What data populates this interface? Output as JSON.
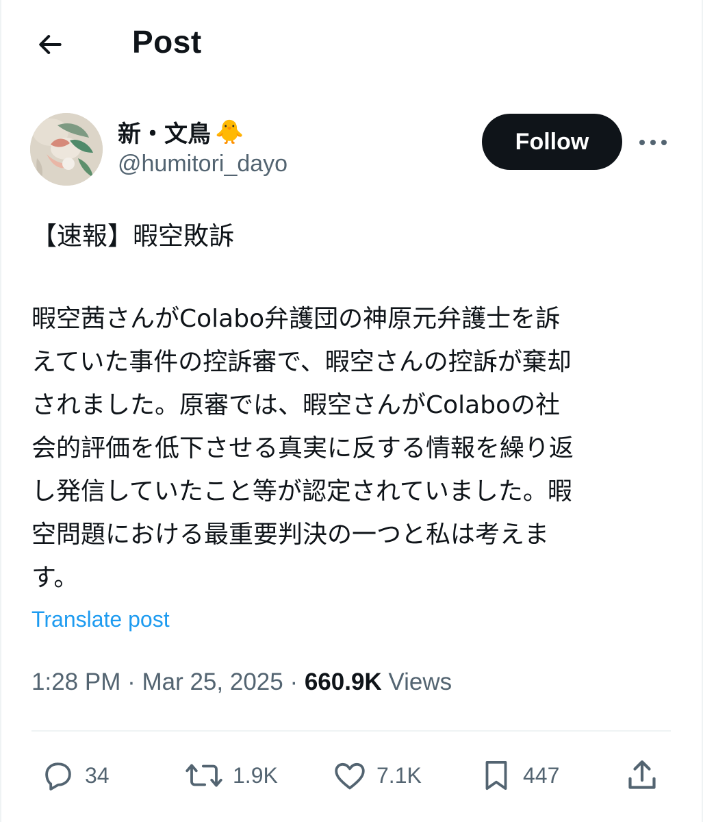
{
  "header": {
    "title": "Post",
    "back_icon": "arrow-left-icon"
  },
  "author": {
    "display_name": "新・文鳥",
    "name_emoji": "🐥",
    "handle": "@humitori_dayo",
    "avatar_icon": "avatar-image"
  },
  "follow_label": "Follow",
  "more_icon": "more-horizontal-icon",
  "post": {
    "headline": "【速報】暇空敗訴",
    "body_lines": [
      "暇空茜さんがColabo弁護団の神原元弁護士を訴",
      "えていた事件の控訴審で、暇空さんの控訴が棄却",
      "されました。原審では、暇空さんがColaboの社",
      "会的評価を低下させる真実に反する情報を繰り返",
      "し発信していたこと等が認定されていました。暇",
      "空問題における最重要判決の一つと私は考えま",
      "す。"
    ],
    "translate_label": "Translate post"
  },
  "meta": {
    "time": "1:28 PM",
    "sep1": " · ",
    "date": "Mar 25, 2025",
    "sep2": " · ",
    "views_count": "660.9K",
    "views_label": " Views"
  },
  "actions": {
    "replies": "34",
    "reposts": "1.9K",
    "likes": "7.1K",
    "bookmarks": "447"
  },
  "colors": {
    "text": "#0f1419",
    "secondary": "#536471",
    "link": "#1d9bf0",
    "divider": "#eff3f4"
  }
}
